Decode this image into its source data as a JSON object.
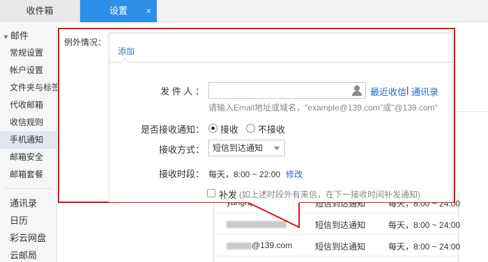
{
  "tabs": {
    "inbox": "收件箱",
    "settings": "设置",
    "close": "×"
  },
  "sidebar": {
    "section": "邮件",
    "items": [
      {
        "label": "常规设置"
      },
      {
        "label": "帐户设置"
      },
      {
        "label": "文件夹与标签"
      },
      {
        "label": "代收邮箱"
      },
      {
        "label": "收信规则"
      },
      {
        "label": "手机通知"
      },
      {
        "label": "邮箱安全"
      },
      {
        "label": "邮箱套餐"
      }
    ],
    "extra": [
      {
        "label": "通讯录"
      },
      {
        "label": "日历"
      },
      {
        "label": "彩云网盘"
      },
      {
        "label": "云邮局"
      }
    ]
  },
  "popup": {
    "label": "例外情况：",
    "tab_add": "添加",
    "sender_label": "发 件 人 ：",
    "sender_value": "",
    "recent_link": "最近收信",
    "separator": "|",
    "contacts_link": "通讯录",
    "sender_hint": "请输入Email地址或域名，\"example@139.com\"或\"@139.com\"",
    "notify_label": "是否接收通知：",
    "notify_options": [
      "接收",
      "不接收"
    ],
    "notify_selected": "接收",
    "method_label": "接收方式：",
    "method_value": "短信到达通知",
    "time_label": "接收时段：",
    "time_value": "每天，8:00 ~ 22:00",
    "time_edit": "修改",
    "reissue_label": "补发",
    "reissue_checked": false,
    "reissue_note": "(如上述时段外有来信，在下一接收时间补发通知)"
  },
  "background_table": {
    "rows": [
      {
        "sender": "yangrq",
        "method": "短信到达通知",
        "time": "每天，8:00 ~ 24:00"
      },
      {
        "sender": "",
        "method": "短信到达通知",
        "time": "每天，8:00 ~ 24:00"
      },
      {
        "sender": "@139.com",
        "method": "短信到达通知",
        "time": "每天，8:00 ~ 24:00"
      }
    ]
  },
  "colors": {
    "accent_blue": "#2d8fe8",
    "link_blue": "#1e6bc8",
    "highlight_red": "#d6151f"
  },
  "icons": {
    "contact": "person-icon",
    "dropdown": "chevron-down-icon"
  }
}
